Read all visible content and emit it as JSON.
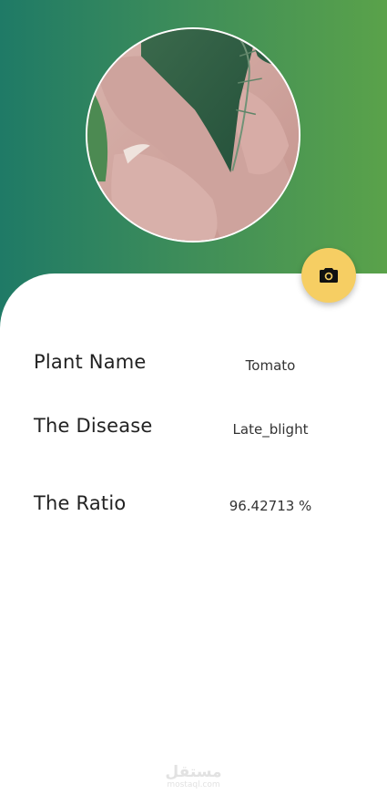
{
  "colors": {
    "header_gradient_start": "#1f7a66",
    "header_gradient_end": "#5aa24a",
    "fab": "#f6ce63",
    "label": "#222222",
    "value": "#333333"
  },
  "photo": {
    "icon": "leaf-in-hand-photo"
  },
  "camera_button": {
    "icon": "camera-icon"
  },
  "results": {
    "plant_name_label": "Plant Name",
    "plant_name_value": "Tomato",
    "disease_label": "The Disease",
    "disease_value": "Late_blight",
    "ratio_label": "The Ratio",
    "ratio_value": "96.42713 %"
  },
  "watermark": {
    "main": "مستقل",
    "sub": "mostaql.com"
  }
}
